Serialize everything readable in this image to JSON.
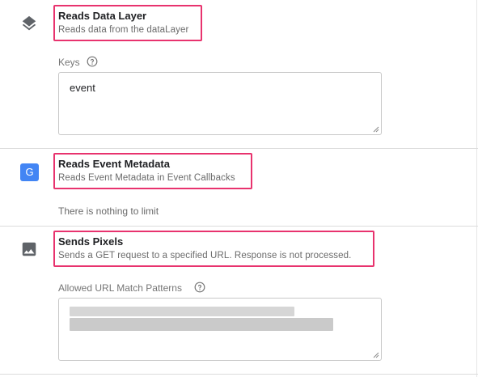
{
  "sections": [
    {
      "title": "Reads Data Layer",
      "description": "Reads data from the dataLayer",
      "icon": "layers-icon",
      "field": {
        "label": "Keys",
        "value": "event"
      }
    },
    {
      "title": "Reads Event Metadata",
      "description": "Reads Event Metadata in Event Callbacks",
      "icon": "google-g-icon",
      "icon_glyph": "G",
      "message": "There is nothing to limit"
    },
    {
      "title": "Sends Pixels",
      "description": "Sends a GET request to a specified URL. Response is not processed.",
      "icon": "image-icon",
      "field": {
        "label": "Allowed URL Match Patterns",
        "value": ""
      }
    }
  ],
  "colors": {
    "highlight": "#e8336e",
    "google_blue": "#4285f4",
    "icon_gray": "#5f6368"
  }
}
